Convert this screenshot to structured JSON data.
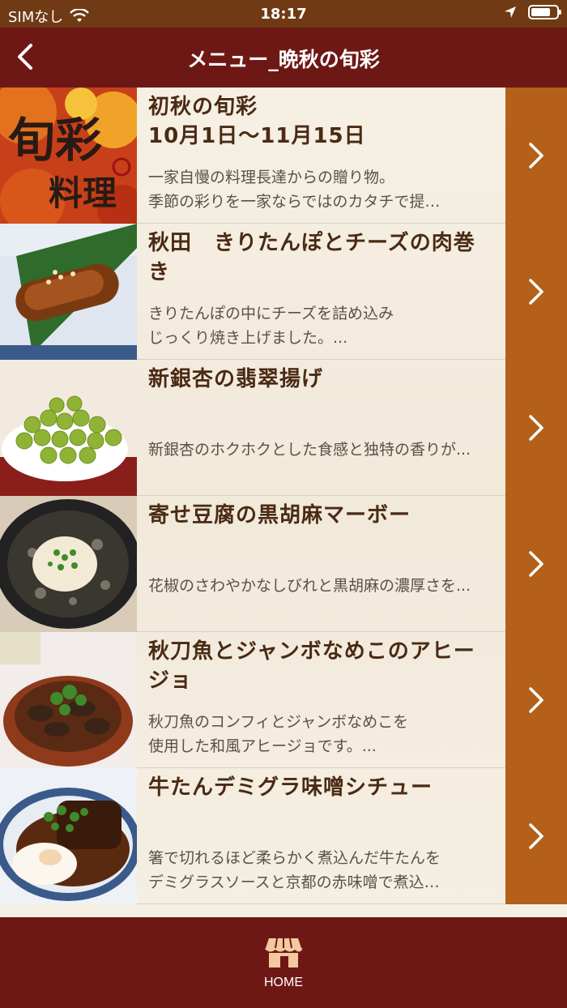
{
  "status": {
    "carrier": "SIMなし",
    "time": "18:17",
    "battery_level": 0.8
  },
  "nav": {
    "title": "メニュー_晩秋の旬彩",
    "back_icon": "chevron-left-icon"
  },
  "items": [
    {
      "title": "初秋の旬彩\n10月1日〜11月15日",
      "desc": "一家自慢の料理長達からの贈り物。\n季節の彩りを一家ならではのカタチで提…",
      "thumb_text": "旬彩料理"
    },
    {
      "title": "秋田　きりたんぽとチーズの肉巻き",
      "desc": "きりたんぽの中にチーズを詰め込み\nじっくり焼き上げました。..."
    },
    {
      "title": "新銀杏の翡翠揚げ",
      "desc": "新銀杏のホクホクとした食感と独特の香りが..."
    },
    {
      "title": "寄せ豆腐の黒胡麻マーボー",
      "desc": "花椒のさわやかなしびれと黒胡麻の濃厚さを..."
    },
    {
      "title": "秋刀魚とジャンボなめこのアヒージョ",
      "desc": "秋刀魚のコンフィとジャンボなめこを\n使用した和風アヒージョです。..."
    },
    {
      "title": "牛たんデミグラ味噌シチュー",
      "desc": "箸で切れるほど柔らかく煮込んだ牛たんを\nデミグラスソースと京都の赤味噌で煮込…"
    }
  ],
  "tabbar": {
    "home_label": "HOME",
    "home_icon": "store-icon"
  },
  "colors": {
    "status_bg": "#6f3a14",
    "nav_bg": "#6e1816",
    "chevron_bg": "#b4601a",
    "title_text": "#4a2a14"
  }
}
